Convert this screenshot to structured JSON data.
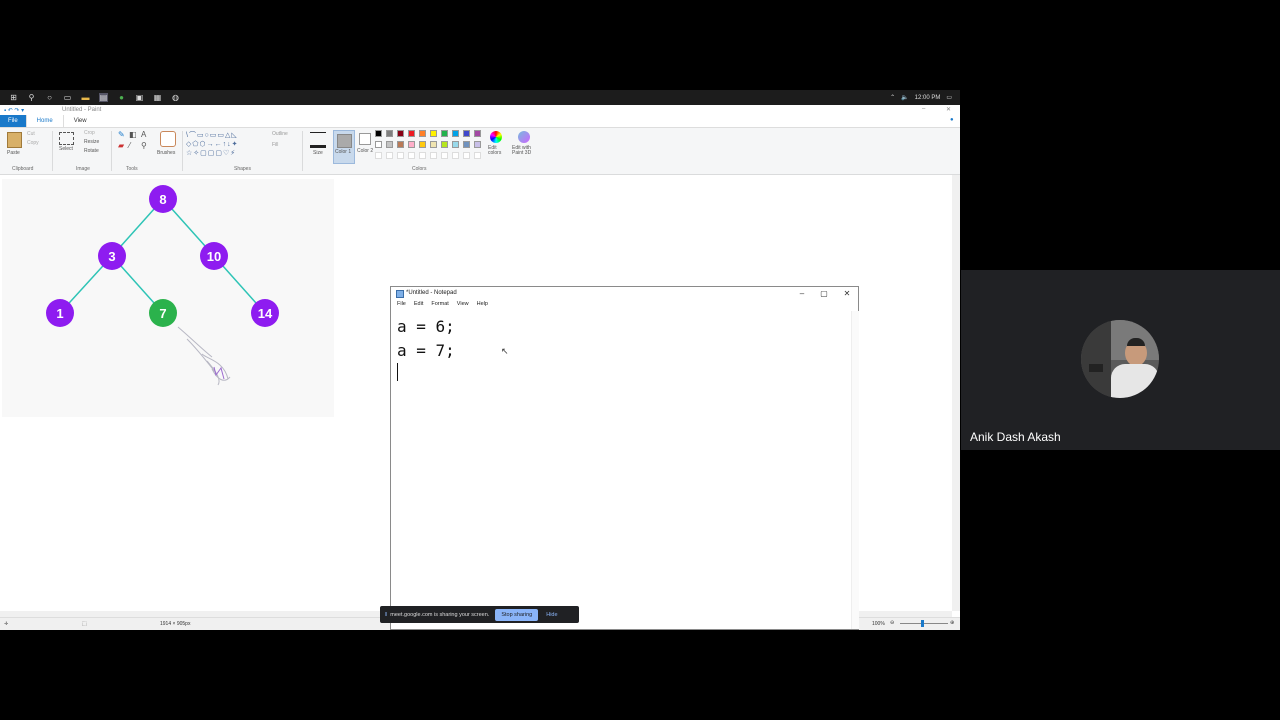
{
  "paint": {
    "title": "Untitled - Paint",
    "tabs": [
      "File",
      "Home",
      "View"
    ],
    "clipboard": {
      "paste": "Paste",
      "cut": "Cut",
      "copy": "Copy",
      "label": "Clipboard"
    },
    "image": {
      "select": "Select",
      "crop": "Crop",
      "resize": "Resize",
      "rotate": "Rotate",
      "label": "Image"
    },
    "tools_label": "Tools",
    "brushes": "Brushes",
    "shapes": {
      "outline": "Outline",
      "fill": "Fill",
      "label": "Shapes"
    },
    "size": "Size",
    "color1": "Color 1",
    "color2": "Color 2",
    "colors_label": "Colors",
    "edit_colors": "Edit colors",
    "edit_paint3d": "Edit with Paint 3D",
    "palette": [
      "#000000",
      "#7f7f7f",
      "#880015",
      "#ed1c24",
      "#ff7f27",
      "#fff200",
      "#22b14c",
      "#00a2e8",
      "#3f48cc",
      "#a349a4",
      "#ffffff",
      "#c3c3c3",
      "#b97a57",
      "#ffaec9",
      "#ffc90e",
      "#efe4b0",
      "#b5e61d",
      "#99d9ea",
      "#7092be",
      "#c8bfe7"
    ],
    "tree": {
      "nodes": [
        "8",
        "3",
        "10",
        "1",
        "7",
        "14"
      ],
      "node_color": "#8e1cf0",
      "edge_color": "#2ec4b6",
      "highlight_color": "#2bb24c"
    },
    "status": {
      "dimensions": "1914 × 905px",
      "zoom": "100%"
    }
  },
  "notepad": {
    "title": "*Untitled - Notepad",
    "menu": [
      "File",
      "Edit",
      "Format",
      "View",
      "Help"
    ],
    "text": "a = 6;\na = 7;\n"
  },
  "taskbar": {
    "time": "12:00 PM"
  },
  "share_bar": {
    "message": "meet.google.com is sharing your screen.",
    "stop": "Stop sharing",
    "hide": "Hide"
  },
  "participant": {
    "name": "Anik Dash Akash"
  }
}
